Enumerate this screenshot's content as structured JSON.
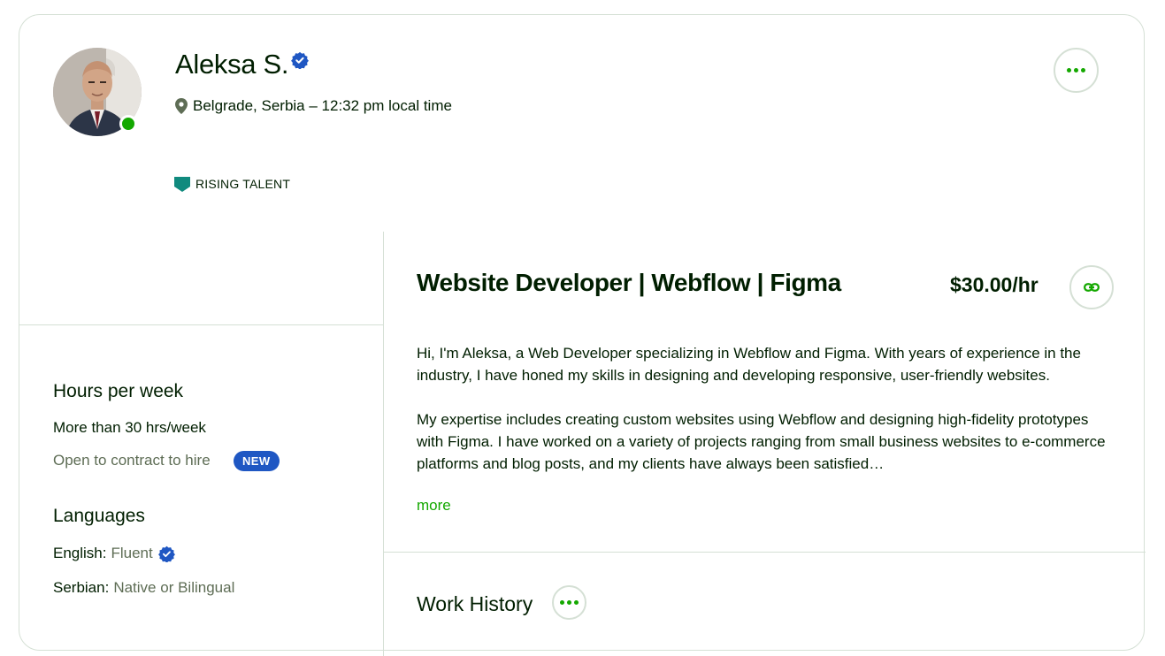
{
  "profile": {
    "name": "Aleksa S.",
    "location": "Belgrade, Serbia – 12:32 pm local time",
    "badge": "RISING TALENT"
  },
  "sidebar": {
    "hours": {
      "title": "Hours per week",
      "value": "More than 30 hrs/week",
      "contract_text": "Open to contract to hire",
      "new_badge": "NEW"
    },
    "languages": {
      "title": "Languages",
      "items": [
        {
          "name": "English:",
          "level": "Fluent"
        },
        {
          "name": "Serbian:",
          "level": "Native or Bilingual"
        }
      ]
    }
  },
  "main": {
    "title": "Website Developer | Webflow | Figma",
    "rate": "$30.00/hr",
    "overview": [
      "Hi, I'm Aleksa, a Web Developer specializing in Webflow and Figma. With years of experience in the industry, I have honed my skills in designing and developing responsive, user-friendly websites.",
      "My expertise includes creating custom websites using Webflow and designing high-fidelity prototypes with Figma. I have worked on a variety of projects ranging from small business websites to e-commerce platforms and blog posts, and my clients have always been satisfied…"
    ],
    "more_label": "more",
    "work_history_title": "Work History"
  },
  "icons": {
    "verified": "verified-badge-icon",
    "location": "map-pin-icon",
    "rising_talent": "rising-talent-badge-icon",
    "more": "ellipsis-icon",
    "link": "link-icon"
  },
  "colors": {
    "brand_green": "#14a800",
    "verified_blue": "#1f57c3",
    "badge_teal": "#108a7e",
    "muted_text": "#5e6d55",
    "border": "#d5e0d5"
  }
}
